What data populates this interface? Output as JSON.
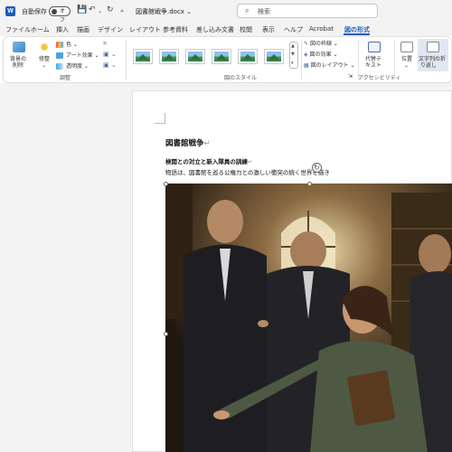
{
  "titlebar": {
    "app_icon": "word-icon",
    "app_letter": "W",
    "autosave_label": "自動保存",
    "toggle_state": "オフ",
    "filename": "図書館戦争.docx",
    "search_placeholder": "検索",
    "colors": {
      "background": "#f3f3f3",
      "word_blue": "#185abd"
    }
  },
  "menu": {
    "tabs": [
      {
        "label": "ファイル"
      },
      {
        "label": "ホーム"
      },
      {
        "label": "挿入"
      },
      {
        "label": "描画"
      },
      {
        "label": "デザイン"
      },
      {
        "label": "レイアウト"
      },
      {
        "label": "参考資料"
      },
      {
        "label": "差し込み文書"
      },
      {
        "label": "校閲"
      },
      {
        "label": "表示"
      },
      {
        "label": "ヘルプ"
      },
      {
        "label": "Acrobat"
      },
      {
        "label": "図の形式",
        "active": true
      }
    ]
  },
  "ribbon": {
    "remove_background": "背景の\n削除",
    "corrections": "修整",
    "color": "色",
    "artistic_effects": "アート効果",
    "transparency": "透明度",
    "adjust_group": "調整",
    "picture_styles_group": "図のスタイル",
    "picture_border": "図の枠線",
    "picture_effects": "図の効果",
    "picture_layout": "図のレイアウト",
    "alt_text": "代替テ\nキスト",
    "accessibility_group": "アクセシビリティ",
    "position": "位置",
    "wrap_text": "文字列の折\n り返し"
  },
  "document": {
    "title": "図書館戦争",
    "heading": "検閲との対立と新入隊員の訓練",
    "body": "物語は、図書館を巡る公権力との激しい衝突の続く世界を描き",
    "paragraph_mark": "↵"
  }
}
